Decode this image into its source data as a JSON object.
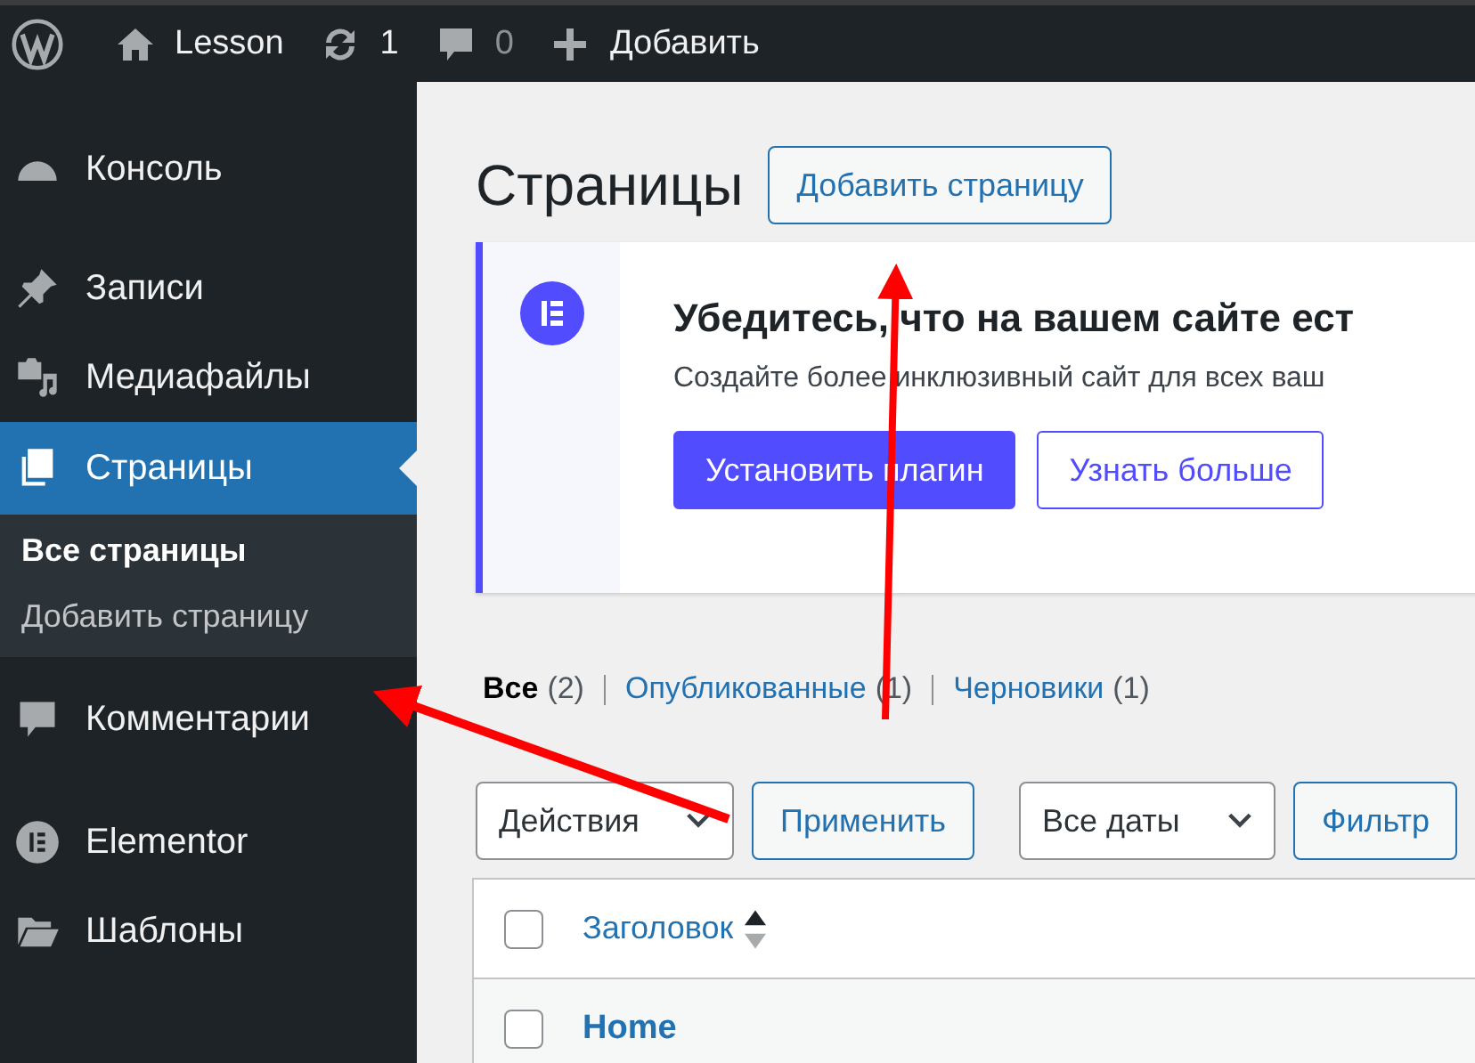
{
  "top_bar": {
    "site_name": "Lesson",
    "updates_count": "1",
    "comments_count": "0",
    "new_label": "Добавить"
  },
  "sidebar": {
    "items": [
      {
        "label": "Консоль",
        "selected": false
      },
      {
        "label": "Записи",
        "selected": false
      },
      {
        "label": "Медиафайлы",
        "selected": false
      },
      {
        "label": "Страницы",
        "selected": true,
        "children": [
          {
            "label": "Все страницы",
            "selected": true
          },
          {
            "label": "Добавить страницу",
            "selected": false
          }
        ]
      },
      {
        "label": "Комментарии",
        "selected": false
      },
      {
        "label": "Elementor",
        "selected": false
      },
      {
        "label": "Шаблоны",
        "selected": false
      }
    ]
  },
  "page": {
    "title": "Страницы",
    "add_button": "Добавить страницу"
  },
  "notice": {
    "title": "Убедитесь, что на вашем сайте ест",
    "text": "Создайте более инклюзивный сайт для всех ваш",
    "buttons": [
      {
        "label": "Установить плагин",
        "kind": "primary"
      },
      {
        "label": "Узнать больше",
        "kind": "secondary"
      }
    ]
  },
  "filters": [
    {
      "label": "Все",
      "count": "(2)",
      "selected": true
    },
    {
      "label": "Опубликованные",
      "count": "(1)",
      "selected": false
    },
    {
      "label": "Черновики",
      "count": "(1)",
      "selected": false
    }
  ],
  "bulk_actions": {
    "select": "Действия",
    "apply": "Применить"
  },
  "date_filter": {
    "select": "Все даты",
    "button": "Фильтр"
  },
  "table": {
    "columns": [
      {
        "label": "Заголовок"
      }
    ],
    "rows": [
      {
        "title": "Home",
        "checked": false
      }
    ],
    "header_checked": false
  }
}
